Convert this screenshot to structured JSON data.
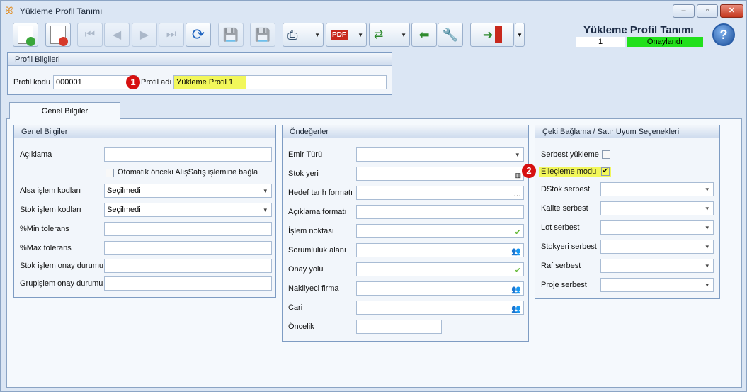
{
  "window": {
    "title": "Yükleme Profil Tanımı",
    "min": "–",
    "max": "▫",
    "close": "✕"
  },
  "header": {
    "form_title": "Yükleme Profil Tanımı",
    "record_no": "1",
    "status": "Onaylandı",
    "help": "?"
  },
  "profil": {
    "header": "Profil Bilgileri",
    "kod_label": "Profil kodu",
    "kod_value": "000001",
    "ad_label": "Profil adı",
    "ad_value": "Yükleme Profil 1",
    "marker": "1"
  },
  "tab": {
    "label": "Genel Bilgiler"
  },
  "genel": {
    "header": "Genel Bilgiler",
    "aciklama_label": "Açıklama",
    "aciklama_value": "",
    "otomatik_label": "Otomatik önceki AlışSatış işlemine bağla",
    "alsa_label": "Alsa işlem kodları",
    "alsa_value": "Seçilmedi",
    "stok_label": "Stok işlem kodları",
    "stok_value": "Seçilmedi",
    "min_label": "%Min tolerans",
    "max_label": "%Max tolerans",
    "stok_onay_label": "Stok işlem onay durumu",
    "grup_onay_label": "Grupişlem onay durumu"
  },
  "ondegerler": {
    "header": "Öndeğerler",
    "emir_label": "Emir Türü",
    "stok_yeri_label": "Stok yeri",
    "hedef_label": "Hedef tarih formatı",
    "aciklama_format_label": "Açıklama formatı",
    "islem_noktasi_label": "İşlem noktası",
    "sorumluluk_label": "Sorumluluk alanı",
    "onay_yolu_label": "Onay yolu",
    "nakliyeci_label": "Nakliyeci firma",
    "cari_label": "Cari",
    "oncelik_label": "Öncelik"
  },
  "ceki": {
    "header": "Çeki Bağlama / Satır Uyum Seçenekleri",
    "serbest_label": "Serbest yükleme",
    "ellecleme_label": "Elleçleme modu",
    "marker": "2",
    "dstok_label": "DStok serbest",
    "kalite_label": "Kalite serbest",
    "lot_label": "Lot serbest",
    "stokyeri_label": "Stokyeri serbest",
    "raf_label": "Raf serbest",
    "proje_label": "Proje serbest"
  },
  "colors": {
    "status_bg": "#22e01c",
    "highlight": "#f2f75a",
    "marker": "#d61010",
    "panel_border": "#7e9cc3"
  }
}
